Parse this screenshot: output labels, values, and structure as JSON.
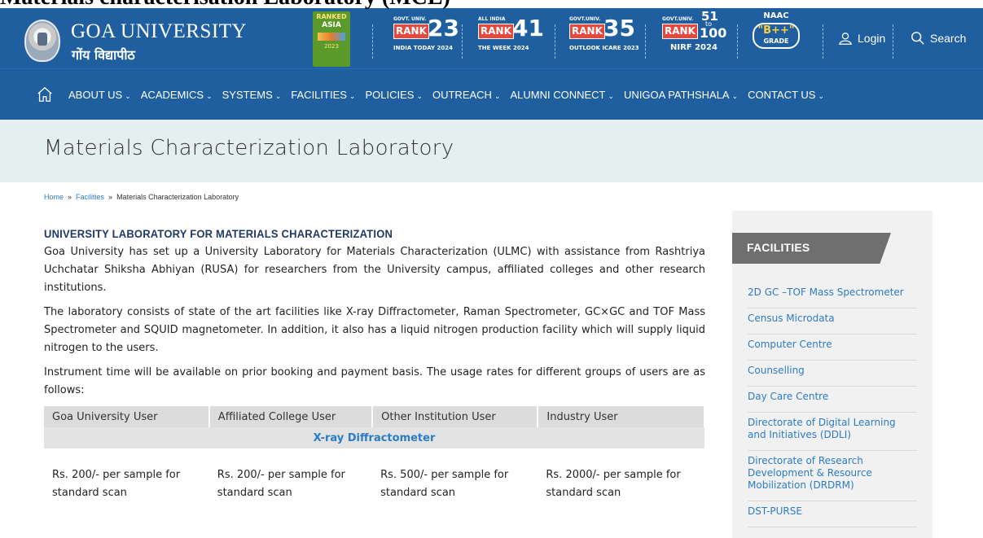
{
  "doc_title": "Materials characterisation Laboratory (MCL)",
  "header": {
    "university_name": "GOA UNIVERSITY",
    "university_name_hindi": "गोंय विद्यापीठ",
    "asia_badge": {
      "line1": "RANKED",
      "line2": "ASIA",
      "year": "2023"
    },
    "ranks": [
      {
        "caption": "GOVT. UNIV.",
        "word": "RANK",
        "number": "23",
        "source": "INDIA TODAY 2024"
      },
      {
        "caption": "ALL INDIA",
        "word": "RANK",
        "number": "41",
        "source": "THE WEEK 2024"
      },
      {
        "caption": "GOVT.UNIV.",
        "word": "RANK",
        "number": "35",
        "source": "OUTLOOK ICARE 2023"
      },
      {
        "caption": "GOVT.UNIV.",
        "word": "RANK",
        "number": "51",
        "number_to": "to",
        "number2": "100",
        "source": "NIRF 2024"
      }
    ],
    "naac": {
      "title": "NAAC",
      "grade": "\"B++\"",
      "grade_label": "GRADE"
    },
    "login_label": "Login",
    "search_label": "Search"
  },
  "nav": {
    "items": [
      "ABOUT US",
      "ACADEMICS",
      "SYSTEMS",
      "FACILITIES",
      "POLICIES",
      "OUTREACH",
      "ALUMNI CONNECT",
      "UNIGOA PATHSHALA",
      "CONTACT US"
    ]
  },
  "page_title": "Materials Characterization Laboratory",
  "breadcrumb": {
    "home": "Home",
    "sep": "»",
    "facilities": "Facilities",
    "current": "Materials Characterization Laboratory"
  },
  "content": {
    "heading": "UNIVERSITY LABORATORY FOR MATERIALS CHARACTERIZATION",
    "paragraphs": [
      "Goa University has set up a University Laboratory for Materials Characterization (ULMC) with assistance from Rashtriya Uchchatar Shiksha Abhiyan (RUSA) for researchers from the University campus, affiliated colleges and other research institutions.",
      "The laboratory consists of state of the art facilities like X-ray Diffractometer, Raman Spectrometer, GC×GC and TOF Mass Spectrometer and SQUID magnetometer. In addition, it also has a liquid nitrogen production facility which will supply liquid nitrogen to the users.",
      "Instrument time will be available on prior booking and payment basis. The usage rates for different groups of users are as follows:"
    ],
    "table": {
      "headers": [
        "Goa University User",
        "Affiliated College User",
        "Other Institution User",
        "Industry User"
      ],
      "group": "X-ray Diffractometer",
      "rows": [
        [
          "Rs. 200/- per sample for standard scan",
          "Rs. 200/- per sample for standard scan",
          "Rs. 500/- per sample for standard scan",
          "Rs. 2000/- per sample for standard scan"
        ]
      ]
    }
  },
  "sidebar": {
    "title": "FACILITIES",
    "items": [
      "2D GC –TOF Mass Spectrometer",
      "Census Microdata",
      "Computer Centre",
      "Counselling",
      "Day Care Centre",
      "Directorate of Digital Learning and Initiatives (DDLI)",
      "Directorate of Research Development & Resource Mobilization (DRDRM)",
      "DST-PURSE"
    ]
  },
  "colors": {
    "header_blue": "#1f5fa0",
    "title_band": "#e5efef",
    "link_blue": "#2b7cc3",
    "heading_navy": "#1f3a66"
  }
}
